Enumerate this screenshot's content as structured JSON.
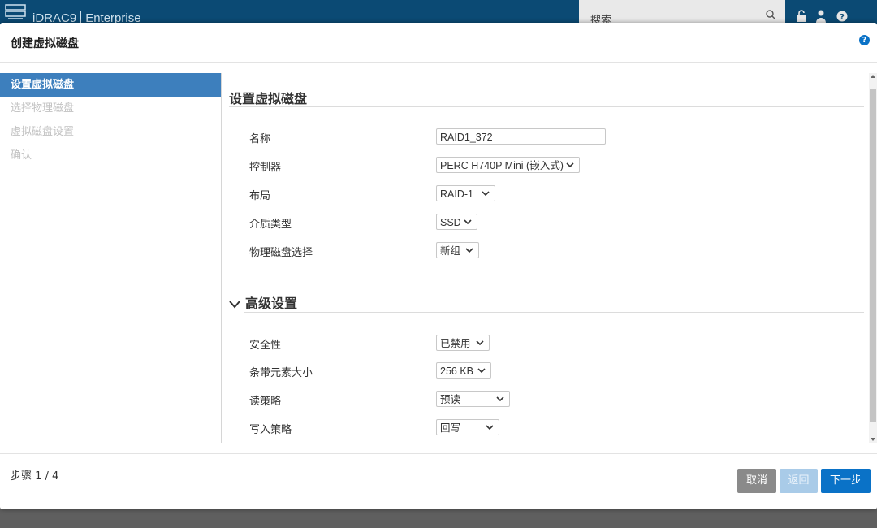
{
  "app": {
    "brand": "iDRAC9",
    "edition": "Enterprise",
    "search_placeholder": "搜索"
  },
  "dialog": {
    "title": "创建虚拟磁盘",
    "help_symbol": "?"
  },
  "steps": [
    {
      "label": "设置虚拟磁盘",
      "active": true
    },
    {
      "label": "选择物理磁盘",
      "active": false
    },
    {
      "label": "虚拟磁盘设置",
      "active": false
    },
    {
      "label": "确认",
      "active": false
    }
  ],
  "form": {
    "section_title": "设置虚拟磁盘",
    "name_label": "名称",
    "name_value": "RAID1_372",
    "controller_label": "控制器",
    "controller_value": "PERC H740P Mini (嵌入式)",
    "layout_label": "布局",
    "layout_value": "RAID-1",
    "media_label": "介质类型",
    "media_value": "SSD",
    "pd_select_label": "物理磁盘选择",
    "pd_select_value": "新组"
  },
  "advanced": {
    "title": "高级设置",
    "security_label": "安全性",
    "security_value": "已禁用",
    "stripe_label": "条带元素大小",
    "stripe_value": "256 KB",
    "read_label": "读策略",
    "read_value": "预读",
    "write_label": "写入策略",
    "write_value": "回写"
  },
  "footer": {
    "step_count": "步骤 1 / 4",
    "cancel": "取消",
    "back": "返回",
    "next": "下一步"
  },
  "colors": {
    "topbar": "#0b4a74",
    "active_step": "#3d7fbd",
    "primary": "#0a72c7",
    "cancel": "#8a8a8a",
    "back_disabled": "#a9cbe8"
  },
  "icons": {
    "logo": "server-logo-icon",
    "search": "search-icon",
    "lock": "lock-icon",
    "user": "user-icon",
    "help": "help-icon",
    "chevron": "chevron-down-icon"
  }
}
